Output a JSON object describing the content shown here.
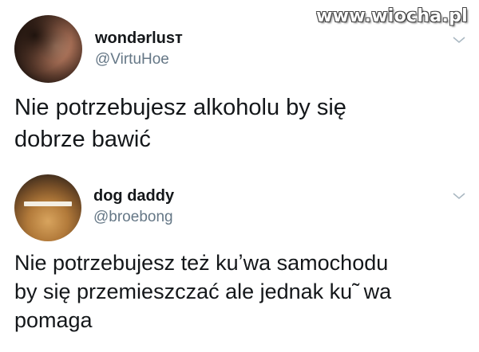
{
  "watermark": "www.wiocha.pl",
  "tweets": [
    {
      "display_name": "wondərlusт",
      "handle": "@VirtuHoe",
      "text": "Nie potrzebujesz alkoholu by się\ndobrze bawić",
      "avatar_icon": "profile-photo-woman",
      "menu_icon": "chevron-down-icon"
    },
    {
      "display_name": "dog daddy",
      "handle": "@broebong",
      "text": "Nie potrzebujesz też kuʼwa samochodu\nby się przemieszczać ale jednak ku˜ wa\npomaga",
      "avatar_icon": "profile-photo-dog",
      "menu_icon": "chevron-down-icon"
    }
  ],
  "colors": {
    "text": "#14171a",
    "secondary": "#657786",
    "background": "#ffffff"
  }
}
